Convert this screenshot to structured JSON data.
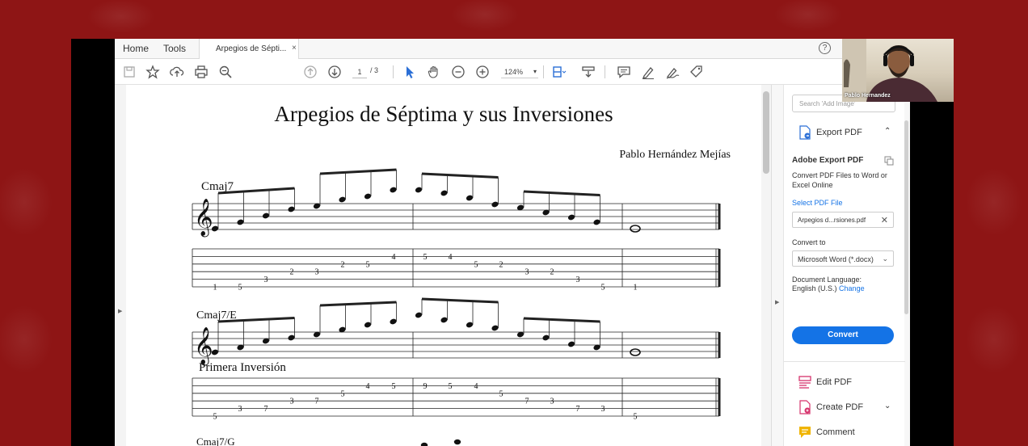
{
  "tabs": {
    "home": "Home",
    "tools": "Tools",
    "document": "Arpegios de Sépti...",
    "close": "×",
    "help": "?"
  },
  "toolbar": {
    "page_current": "1",
    "page_total": "/ 3",
    "zoom": "124%"
  },
  "document": {
    "title": "Arpegios de Séptima y sus Inversiones",
    "author": "Pablo Hernández Mejías",
    "sections": [
      {
        "chord": "Cmaj7",
        "chord_suffix": "",
        "subtitle": "",
        "tab_numbers": [
          "1",
          "5",
          "3",
          "2",
          "3",
          "2",
          "5",
          "4",
          "5",
          "4",
          "5",
          "2",
          "3",
          "2",
          "3",
          "5",
          "1"
        ]
      },
      {
        "chord": "Cmaj7",
        "chord_suffix": "/E",
        "subtitle": "Primera Inversión",
        "tab_numbers": [
          "5",
          "3",
          "7",
          "3",
          "7",
          "5",
          "4",
          "5",
          "9",
          "5",
          "4",
          "5",
          "7",
          "3",
          "7",
          "3",
          "5"
        ]
      },
      {
        "chord": "Cmaj7",
        "chord_suffix": "/G",
        "subtitle": "",
        "tab_numbers": []
      }
    ]
  },
  "right_pane": {
    "search_placeholder": "Search 'Add Image'",
    "export_pdf": "Export PDF",
    "adobe_export_title": "Adobe Export PDF",
    "adobe_export_desc": "Convert PDF Files to Word or Excel Online",
    "select_pdf": "Select PDF File",
    "file_name": "Arpegios d...rsiones.pdf",
    "convert_to": "Convert to",
    "format": "Microsoft Word (*.docx)",
    "doc_language": "Document Language:",
    "language": "English (U.S.)",
    "change": "Change",
    "convert_button": "Convert",
    "edit_pdf": "Edit PDF",
    "create_pdf": "Create PDF",
    "comment": "Comment"
  },
  "webcam": {
    "name": "Pablo Hernandez"
  },
  "colors": {
    "background": "#8e1515",
    "accent": "#1473e6"
  }
}
